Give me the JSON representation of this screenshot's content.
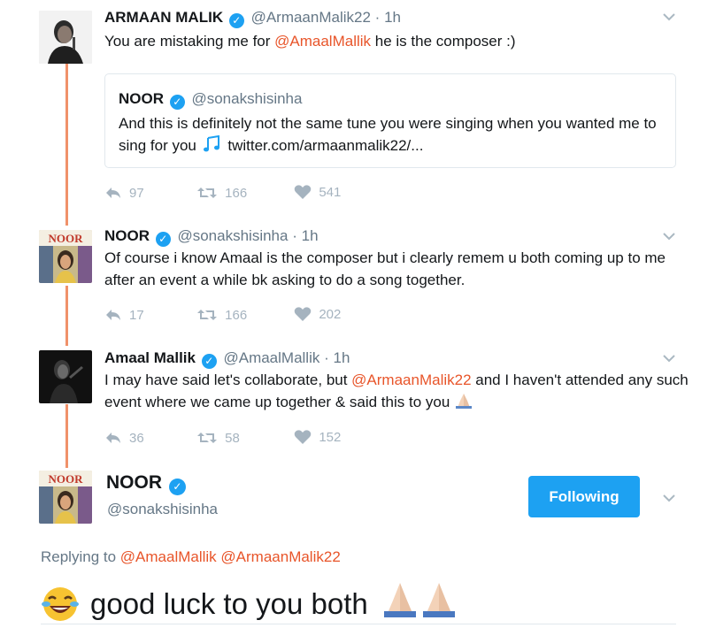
{
  "thread": [
    {
      "name": "ARMAAN MALIK",
      "handle": "@ArmaanMalik22",
      "time": "1h",
      "text_before": "You are mistaking me for ",
      "mention": "@AmaalMallik",
      "text_after": " he is the composer :)",
      "quote": {
        "name": "NOOR",
        "handle": "@sonakshisinha",
        "text": "And this is definitely not the same tune you were singing when you wanted me to sing for you",
        "link": "twitter.com/armaanmalik22/..."
      },
      "replies": "97",
      "retweets": "166",
      "likes": "541"
    },
    {
      "name": "NOOR",
      "handle": "@sonakshisinha",
      "time": "1h",
      "text": "Of course i know Amaal is the composer but i clearly remem u both coming up to me after an event a while bk asking to do a song together.",
      "replies": "17",
      "retweets": "166",
      "likes": "202"
    },
    {
      "name": "Amaal Mallik",
      "handle": "@AmaalMallik",
      "time": "1h",
      "text_before": "I may have said let's collaborate, but ",
      "mention": "@ArmaanMalik22",
      "text_after": " and I haven't attended any such event where we came up together & said this to you",
      "replies": "36",
      "retweets": "58",
      "likes": "152"
    }
  ],
  "main": {
    "name": "NOOR",
    "handle": "@sonakshisinha",
    "follow_label": "Following",
    "replying_prefix": "Replying to",
    "replying_mentions": "@AmaalMallik @ArmaanMalik22",
    "text": "good luck to you both"
  },
  "avatar_label": "NOOR",
  "colors": {
    "accent_blue": "#1da1f2",
    "mention_orange": "#e8552a",
    "thread_line": "#f0926a"
  },
  "icons": [
    "verified-icon",
    "chevron-down-icon",
    "reply-icon",
    "retweet-icon",
    "like-icon",
    "music-notes-icon",
    "laughing-crying-emoji-icon",
    "praying-hands-emoji-icon"
  ]
}
